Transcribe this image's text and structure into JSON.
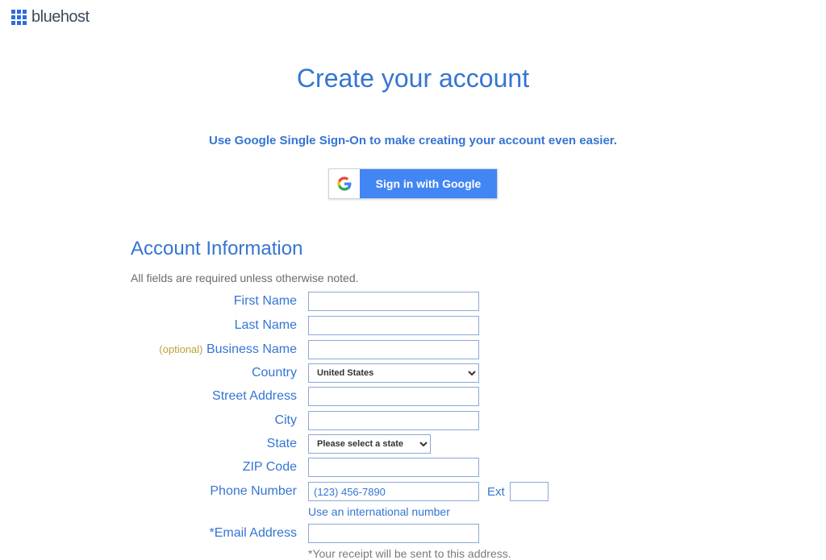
{
  "brand": {
    "name": "bluehost"
  },
  "header": {
    "title": "Create your account",
    "sso_text": "Use Google Single Sign-On to make creating your account even easier.",
    "google_button": "Sign in with Google"
  },
  "section": {
    "title": "Account Information",
    "subtitle": "All fields are required unless otherwise noted."
  },
  "labels": {
    "first_name": "First Name",
    "last_name": "Last Name",
    "optional": "(optional)",
    "business_name": "Business Name",
    "country": "Country",
    "street": "Street Address",
    "city": "City",
    "state": "State",
    "zip": "ZIP Code",
    "phone": "Phone Number",
    "ext": "Ext",
    "email": "*Email Address"
  },
  "values": {
    "country_selected": "United States",
    "state_selected": "Please select a state",
    "phone_placeholder": "(123) 456-7890"
  },
  "helpers": {
    "intl": "Use an international number",
    "receipt": "*Your receipt will be sent to this address."
  }
}
